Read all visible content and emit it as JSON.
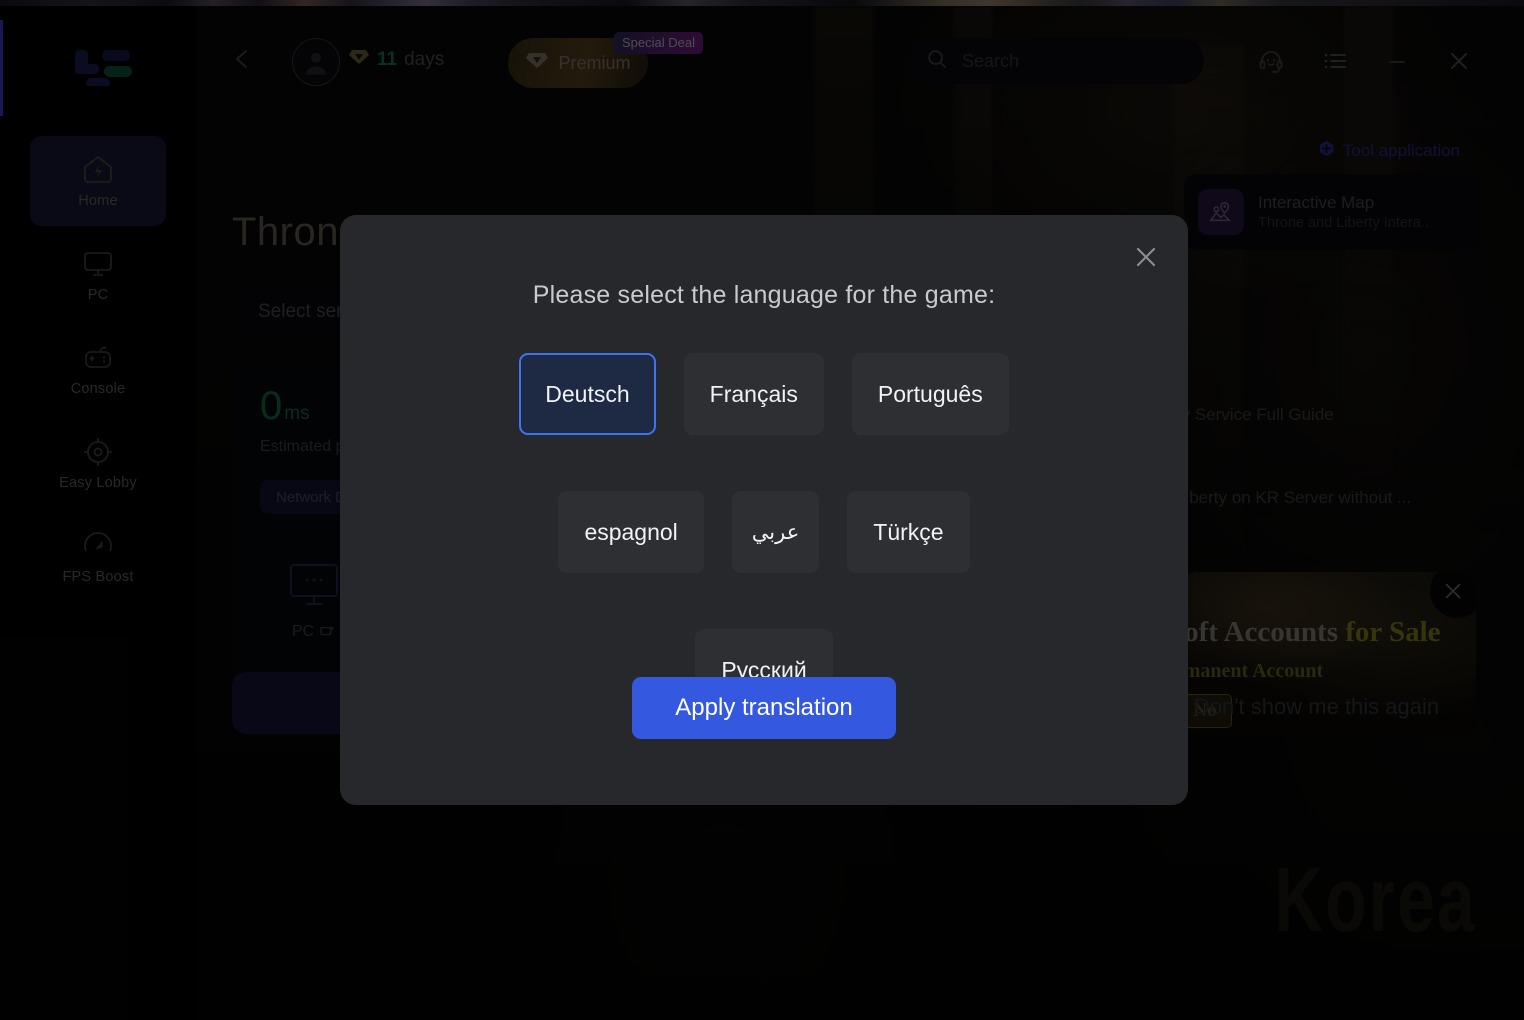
{
  "window": {
    "titlebar_icons": [
      "support-headset-icon",
      "list-menu-icon",
      "minimize-icon",
      "close-icon"
    ]
  },
  "sidebar": {
    "logo_name": "app-logo",
    "items": [
      {
        "label": "Home",
        "icon": "home-bolt-icon",
        "active": true
      },
      {
        "label": "PC",
        "icon": "monitor-icon",
        "active": false
      },
      {
        "label": "Console",
        "icon": "gamepad-icon",
        "active": false
      },
      {
        "label": "Easy Lobby",
        "icon": "crosshair-icon",
        "active": false
      },
      {
        "label": "FPS Boost",
        "icon": "speedometer-icon",
        "active": false
      }
    ]
  },
  "topbar": {
    "back_icon": "chevron-left-icon",
    "avatar_icon": "user-avatar-icon",
    "days_value": "11",
    "days_label": "days",
    "days_icon": "diamond-icon",
    "premium_label": "Premium",
    "premium_icon": "diamond-icon",
    "special_deal_badge": "Special Deal",
    "search_placeholder": "Search",
    "search_icon": "search-icon",
    "support_icon": "headset-icon",
    "list_icon": "list-icon",
    "minimize_icon": "minimize-icon",
    "close_icon": "close-icon"
  },
  "main": {
    "game_title": "Throne",
    "server_select_label": "Select ser",
    "ping_value": "0",
    "ping_unit": "ms",
    "ping_caption": "Estimated pi",
    "network_chip": "Network D",
    "platform_label": "PC",
    "platform_icon": "monitor-dots-icon",
    "accelerate_button": ""
  },
  "right_panel": {
    "tool_application_link": "Tool application",
    "tool_application_icon": "plus-hex-icon",
    "tool_card": {
      "icon": "map-pin-icon",
      "name": "Interactive Map",
      "desc": "Throne and Liberty Intera.."
    },
    "news": [
      "urity Service Full Guide",
      "Liberty on KR Server without ..."
    ],
    "ad": {
      "title_plain": "Soft Accounts ",
      "title_highlight": "for Sale",
      "subtitle": "ermanent Account",
      "cta": "it No",
      "close_icon": "close-icon",
      "dismiss_label": "Don't show me this again"
    }
  },
  "modal": {
    "close_icon": "close-icon",
    "heading": "Please select the language for the game:",
    "languages": [
      {
        "label": "Deutsch",
        "selected": true,
        "rtl": false
      },
      {
        "label": "Français",
        "selected": false,
        "rtl": false
      },
      {
        "label": "Português",
        "selected": false,
        "rtl": false
      },
      {
        "label": "espagnol",
        "selected": false,
        "rtl": false
      },
      {
        "label": "عربي",
        "selected": false,
        "rtl": true
      },
      {
        "label": "Türkçe",
        "selected": false,
        "rtl": false
      },
      {
        "label": "Русский",
        "selected": false,
        "rtl": false
      }
    ],
    "apply_label": "Apply translation"
  },
  "colors": {
    "accent_blue": "#3558e0",
    "selected_border": "#3f74f0",
    "modal_bg": "#27282c",
    "lang_btn_bg": "#2e2f33",
    "ping_green": "#167348",
    "premium_gold": "#5b4722",
    "special_deal_purple": "#7a1f8c"
  }
}
